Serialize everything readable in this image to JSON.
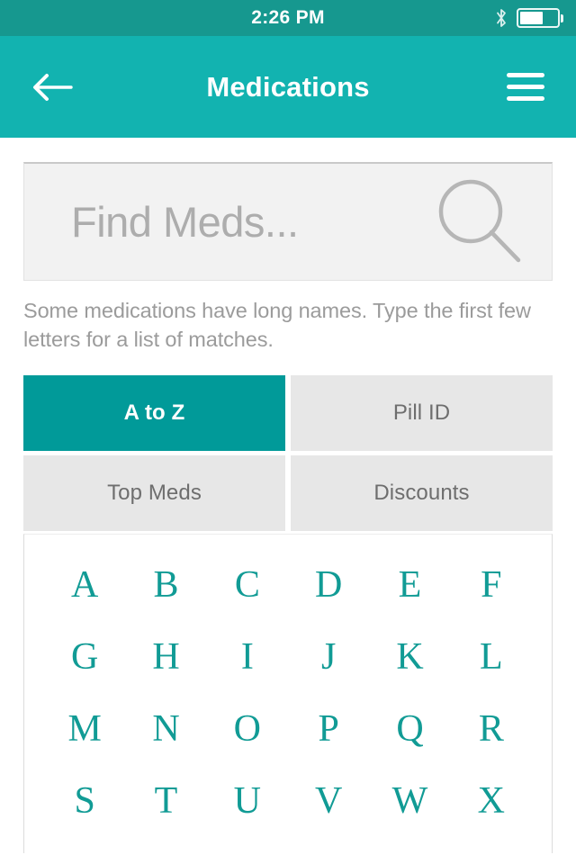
{
  "status": {
    "time": "2:26 PM",
    "bluetooth_icon": "bluetooth-icon",
    "battery_icon": "battery-icon",
    "battery_level": 64
  },
  "header": {
    "title": "Medications",
    "back_icon": "back-arrow-icon",
    "menu_icon": "hamburger-menu-icon",
    "background": "#12B3B0"
  },
  "search": {
    "placeholder": "Find Meds...",
    "value": "",
    "icon": "search-icon"
  },
  "helper": {
    "text": "Some medications have long names. Type the first few letters for a list of matches."
  },
  "tabs": {
    "active_index": 0,
    "items": [
      {
        "label": "A to Z"
      },
      {
        "label": "Pill ID"
      },
      {
        "label": "Top Meds"
      },
      {
        "label": "Discounts"
      }
    ]
  },
  "alphabet": {
    "accent": "#119B95",
    "letters": [
      "A",
      "B",
      "C",
      "D",
      "E",
      "F",
      "G",
      "H",
      "I",
      "J",
      "K",
      "L",
      "M",
      "N",
      "O",
      "P",
      "Q",
      "R",
      "S",
      "T",
      "U",
      "V",
      "W",
      "X"
    ]
  }
}
